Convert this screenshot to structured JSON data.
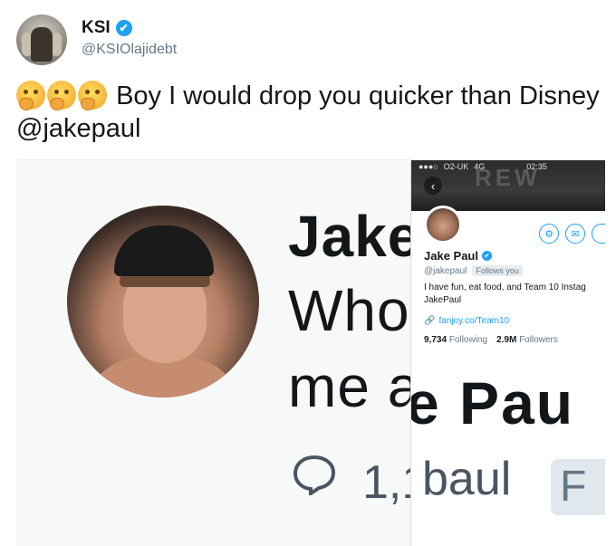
{
  "author": {
    "display_name": "KSI",
    "handle": "@KSIOlajidebt",
    "verified_icon": "✔"
  },
  "tweet": {
    "emojis": [
      "thinking-face",
      "thinking-face",
      "thinking-face"
    ],
    "text": "Boy I would drop you quicker than Disney @jakepaul"
  },
  "background_capture": {
    "name_fragment": "Jake",
    "line2_fragment": "Who",
    "line3_fragment": "me a",
    "reply_count_fragment": "1,1"
  },
  "phone": {
    "status_carrier": "O2-UK",
    "status_network": "4G",
    "status_time": "02:35",
    "back_glyph": "‹",
    "gear_glyph": "⚙",
    "mail_glyph": "✉",
    "name": "Jake Paul",
    "verified_icon": "✔",
    "handle": "@jakepaul",
    "follows_you": "Follows you",
    "bio_line1": "I have fun, eat food, and Team 10 Instag",
    "bio_line2": "JakePaul",
    "link_icon": "🔗",
    "link": "fanjoy.co/Team10",
    "following_count": "9,734",
    "following_label": "Following",
    "followers_count": "2.9M",
    "followers_label": "Followers",
    "big_name_fragment": "e Pau",
    "big_handle_fragment": "baul",
    "big_badge_fragment": "F"
  },
  "colors": {
    "twitter_blue": "#1da1f2",
    "text_primary": "#14171a",
    "text_secondary": "#657786"
  }
}
